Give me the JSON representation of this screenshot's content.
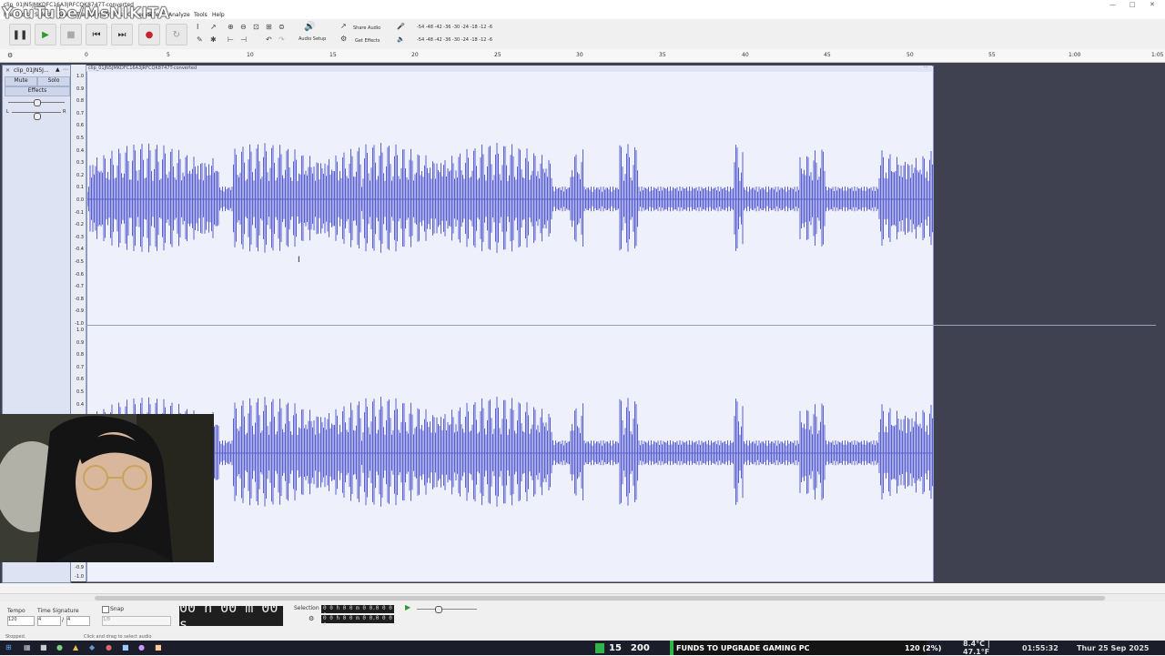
{
  "window": {
    "title": "clip_01JN5JMKDFC16A3JRFCQK8747T-converted",
    "watermark": "YouTube/MsNIKITA"
  },
  "menu": [
    "File",
    "Edit",
    "Select",
    "View",
    "Transport",
    "Tracks",
    "Generate",
    "Effect",
    "Analyze",
    "Tools",
    "Help"
  ],
  "toolbar": {
    "audio_setup": "Audio Setup",
    "share_audio": "Share Audio",
    "get_effects": "Get Effects",
    "meter_scale": "-54 -48 -42 -36 -30 -24 -18 -12 -6"
  },
  "ruler": {
    "ticks": [
      "0",
      "5",
      "10",
      "15",
      "20",
      "25",
      "30",
      "35",
      "40",
      "45",
      "50",
      "55",
      "1:00",
      "1:05"
    ]
  },
  "track": {
    "name": "clip_01JN5J...",
    "mute": "Mute",
    "solo": "Solo",
    "effects": "Effects",
    "pan_left": "L",
    "pan_right": "R",
    "clip_title": "clip_01JN5JMKDFC16A3JRFCQK8747T-converted"
  },
  "vscale_top": [
    "1.0",
    "0.9",
    "0.8",
    "0.7",
    "0.6",
    "0.5",
    "0.4",
    "0.3",
    "0.2",
    "0.1",
    "0.0",
    "-0.1",
    "-0.2",
    "-0.3",
    "-0.4",
    "-0.5",
    "-0.6",
    "-0.7",
    "-0.8",
    "-0.9",
    "-1.0"
  ],
  "vscale_bottom": [
    "1.0",
    "0.9",
    "0.8",
    "0.7",
    "0.6",
    "0.5",
    "0.4"
  ],
  "vscale_bottom_end": [
    "-0.9",
    "-1.0"
  ],
  "bottom": {
    "tempo_label": "Tempo",
    "tempo_value": "120",
    "timesig_label": "Time Signature",
    "timesig_num": "4",
    "timesig_sep": "/",
    "timesig_den": "4",
    "snap_label": "Snap",
    "snap_value": "1/8",
    "time_display": "00 h 00 m 00 s",
    "selection_label": "Selection",
    "selection_start": "0 0 h 0 0 m 0 0.0 0 0 s",
    "selection_end": "0 0 h 0 0 m 0 0.0 0 0 s"
  },
  "status": {
    "left": "Stopped.",
    "hint": "Click and drag to select audio"
  },
  "stream": {
    "count_a": "15",
    "count_b": "200",
    "goal_text": "FUNDS TO UPGRADE GAMING PC",
    "goal_amount": "120 (2%)",
    "weather": "8.4°C | 47.1°F",
    "clock": "01:55:32",
    "date": "Thur 25 Sep 2025"
  },
  "colors": {
    "waveform": "#5a5fd0",
    "clip_bg": "#eef0fb",
    "track_bg": "#3f4150",
    "stream_green": "#2fb54a"
  }
}
